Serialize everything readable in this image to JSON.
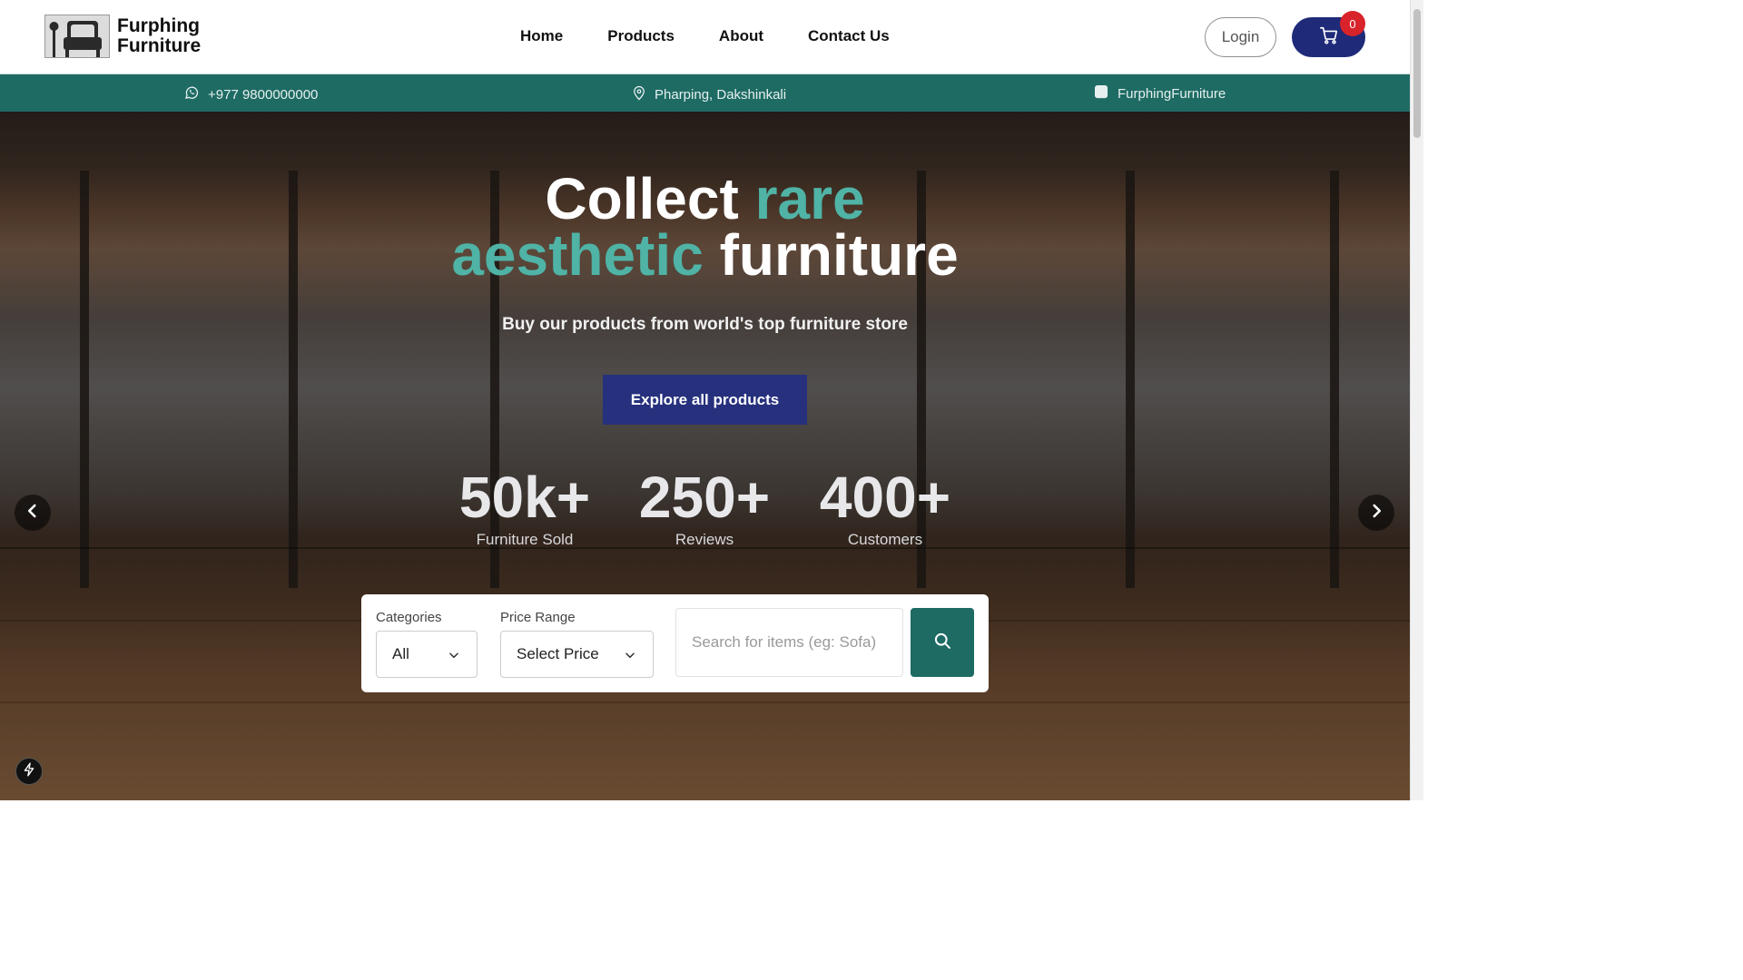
{
  "brand": {
    "name_line1": "Furphing",
    "name_line2": "Furniture",
    "logo_icon": "armchair-logo-icon"
  },
  "nav": {
    "items": [
      {
        "label": "Home"
      },
      {
        "label": "Products"
      },
      {
        "label": "About"
      },
      {
        "label": "Contact Us"
      }
    ]
  },
  "header": {
    "login_label": "Login",
    "cart_count": "0"
  },
  "infobar": {
    "phone": "+977 9800000000",
    "location": "Pharping, Dakshinkali",
    "social": "FurphingFurniture"
  },
  "hero": {
    "title_word1": "Collect",
    "title_word2": "rare",
    "title_word3": "aesthetic",
    "title_word4": "furniture",
    "subtitle": "Buy our products from world's top furniture store",
    "cta_label": "Explore all products",
    "stats": [
      {
        "value": "50k+",
        "label": "Furniture Sold"
      },
      {
        "value": "250+",
        "label": "Reviews"
      },
      {
        "value": "400+",
        "label": "Customers"
      }
    ]
  },
  "search": {
    "categories_label": "Categories",
    "categories_value": "All",
    "price_label": "Price Range",
    "price_value": "Select Price",
    "placeholder": "Search for items (eg: Sofa)"
  },
  "colors": {
    "teal": "#1e6b64",
    "accent": "#4fb3a6",
    "navy": "#1f2b78",
    "badge": "#d8232a"
  }
}
